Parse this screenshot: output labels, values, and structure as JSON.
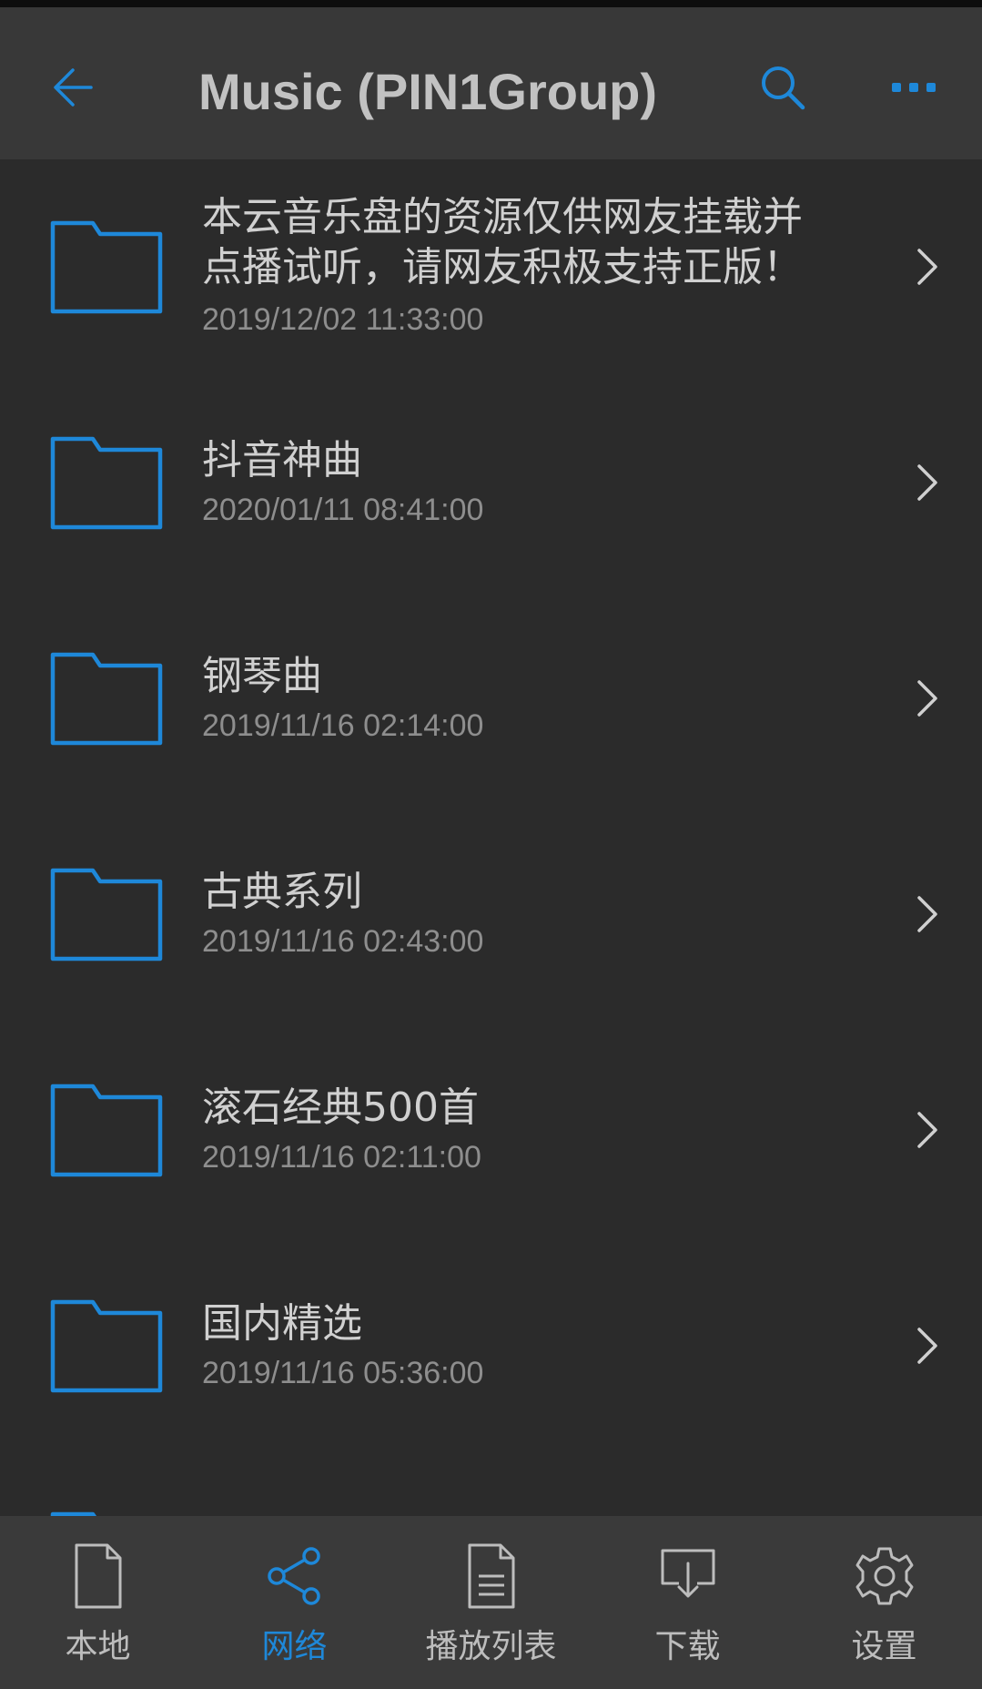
{
  "header": {
    "title": "Music (PIN1Group)",
    "back_icon": "back-arrow-icon",
    "search_icon": "search-icon",
    "more_icon": "more-dots-icon"
  },
  "folders": [
    {
      "title": "本云音乐盘的资源仅供网友挂载并\n点播试听，请网友积极支持正版！",
      "date": "2019/12/02 11:33:00"
    },
    {
      "title": "抖音神曲",
      "date": "2020/01/11 08:41:00"
    },
    {
      "title": "钢琴曲",
      "date": "2019/11/16 02:14:00"
    },
    {
      "title": "古典系列",
      "date": "2019/11/16 02:43:00"
    },
    {
      "title": "滚石经典500首",
      "date": "2019/11/16 02:11:00"
    },
    {
      "title": "国内精选",
      "date": "2019/11/16 05:36:00"
    }
  ],
  "bottom_nav": {
    "items": [
      {
        "label": "本地",
        "icon": "file-icon",
        "active": false
      },
      {
        "label": "网络",
        "icon": "share-icon",
        "active": true
      },
      {
        "label": "播放列表",
        "icon": "playlist-icon",
        "active": false
      },
      {
        "label": "下载",
        "icon": "download-icon",
        "active": false
      },
      {
        "label": "设置",
        "icon": "gear-icon",
        "active": false
      }
    ]
  },
  "colors": {
    "accent": "#1e88d9",
    "background": "#2b2b2b",
    "app_bar": "#383838",
    "bottom_bar": "#3a3a3a",
    "text_primary": "#d0d0d0",
    "text_secondary": "#8e8e8e"
  }
}
